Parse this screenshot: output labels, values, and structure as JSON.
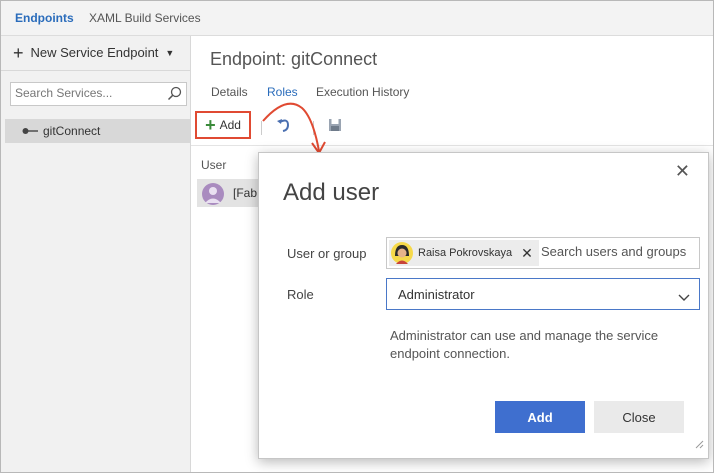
{
  "top_tabs": [
    {
      "label": "Endpoints"
    },
    {
      "label": "XAML Build Services"
    }
  ],
  "sidebar": {
    "new_endpoint_label": "New Service Endpoint",
    "search_placeholder": "Search Services...",
    "items": [
      {
        "label": "gitConnect"
      }
    ]
  },
  "main": {
    "title": "Endpoint: gitConnect",
    "tabs": [
      {
        "label": "Details"
      },
      {
        "label": "Roles"
      },
      {
        "label": "Execution History"
      }
    ],
    "toolbar": {
      "add_label": "Add"
    },
    "table": {
      "column_header": "User",
      "rows": [
        {
          "name": "[Fab"
        }
      ]
    }
  },
  "dialog": {
    "title": "Add user",
    "user_label": "User or group",
    "selected_user": "Raisa Pokrovskaya",
    "search_placeholder": "Search users and groups",
    "role_label": "Role",
    "role_value": "Administrator",
    "description": "Administrator can use and manage the service endpoint connection.",
    "add_button": "Add",
    "close_button": "Close"
  },
  "colors": {
    "accent": "#3f6fcf",
    "annotation": "#e04a32",
    "link": "#2a6cbb"
  }
}
